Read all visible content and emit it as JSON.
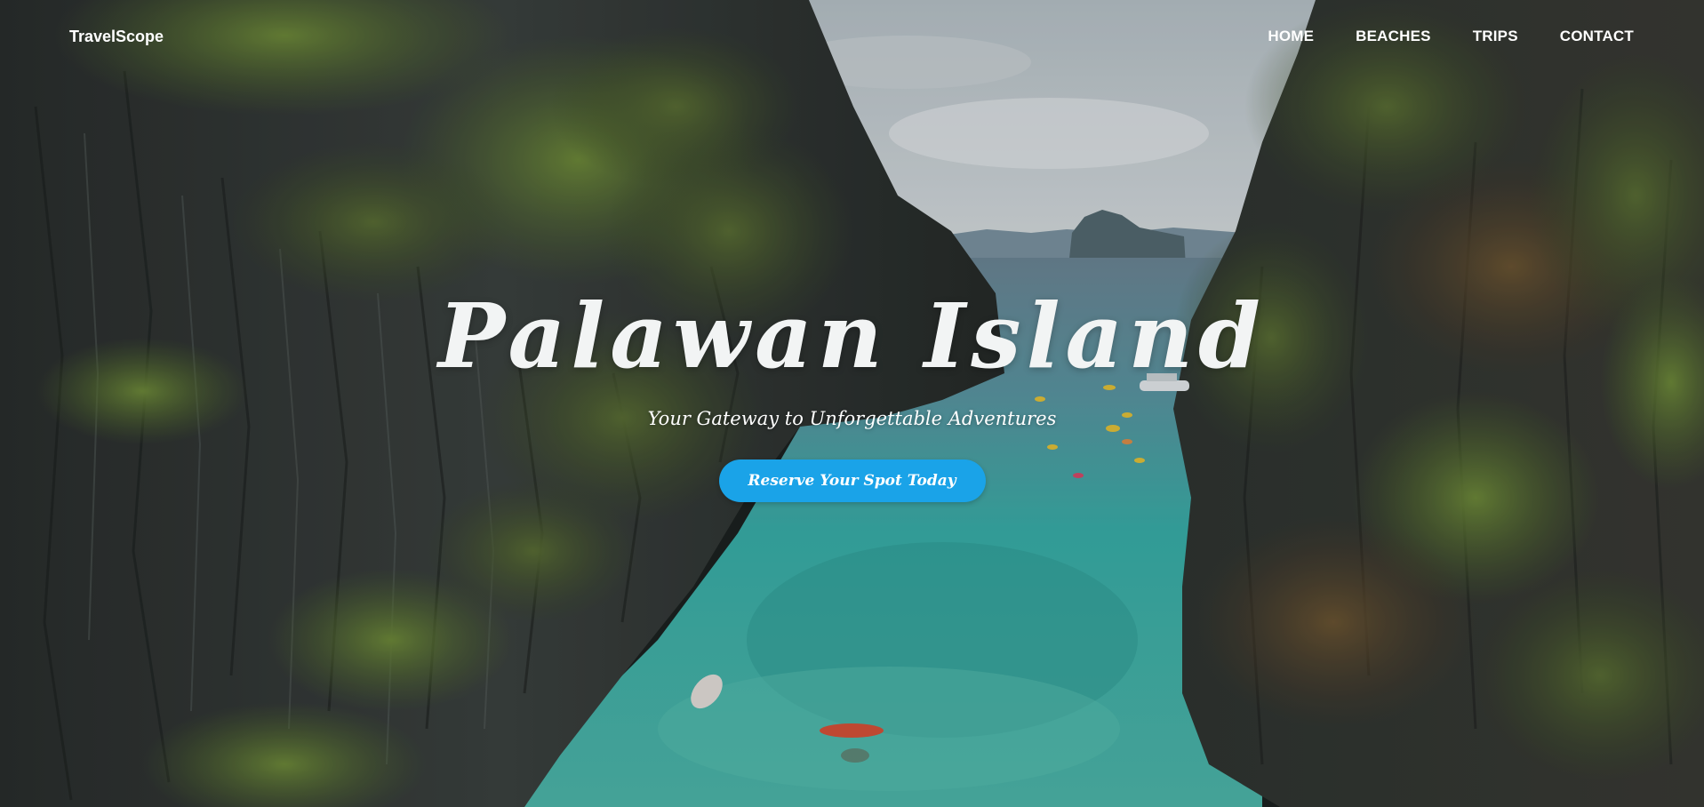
{
  "nav": {
    "logo": "TravelScope",
    "links": [
      "HOME",
      "BEACHES",
      "TRIPS",
      "CONTACT"
    ]
  },
  "hero": {
    "title": "Palawan Island",
    "subtitle": "Your Gateway to Unforgettable Adventures",
    "cta_label": "Reserve Your Spot Today"
  },
  "colors": {
    "cta": "#1aa3e8",
    "text": "#ffffff",
    "lagoon": "#3fb8ae",
    "cliff": "#2b302e"
  }
}
